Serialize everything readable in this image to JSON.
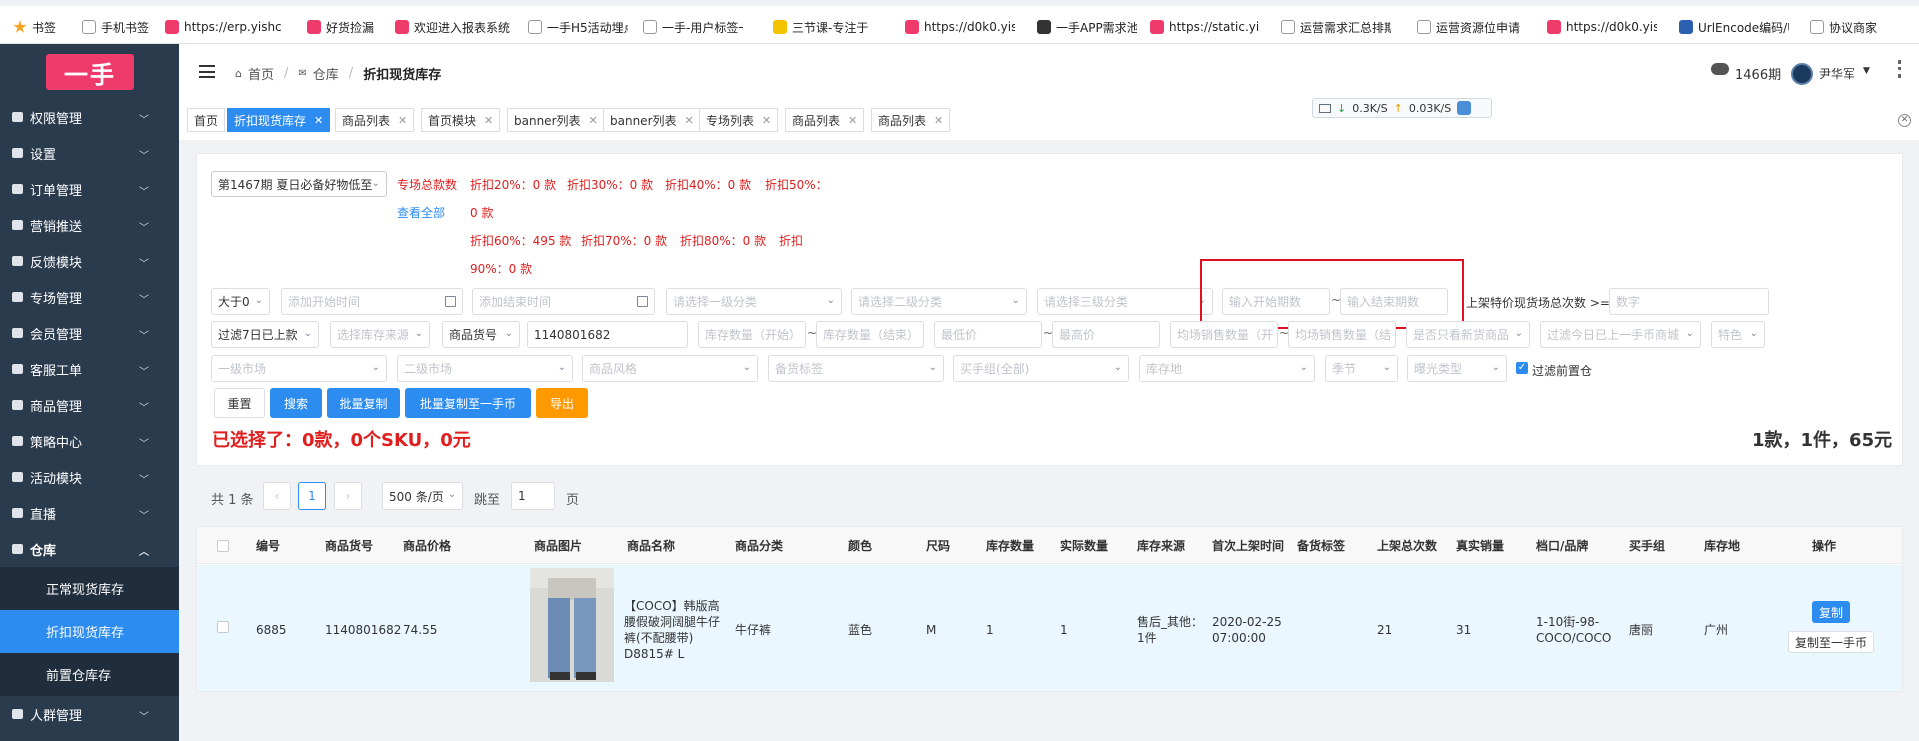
{
  "bookmarks": [
    {
      "label": "书签",
      "icon": "star-icon",
      "color": "#f5a623"
    },
    {
      "label": "手机书签",
      "icon": "page-icon",
      "color": "#999999"
    },
    {
      "label": "https://erp.yishc",
      "icon": "site-icon",
      "color": "#ee3b6b"
    },
    {
      "label": "好货捡漏",
      "icon": "site-icon",
      "color": "#ee3b6b"
    },
    {
      "label": "欢迎进入报表系统",
      "icon": "site-icon",
      "color": "#ee3b6b"
    },
    {
      "label": "一手H5活动埋点",
      "icon": "page-icon",
      "color": "#999999"
    },
    {
      "label": "一手-用户标签一",
      "icon": "page-icon",
      "color": "#999999"
    },
    {
      "label": "三节课-专注于",
      "icon": "site-icon",
      "color": "#f5c400"
    },
    {
      "label": "https://d0k0.yish",
      "icon": "site-icon",
      "color": "#ee3b6b"
    },
    {
      "label": "一手APP需求池",
      "icon": "site-icon",
      "color": "#333333"
    },
    {
      "label": "https://static.yish",
      "icon": "site-icon",
      "color": "#ee3b6b"
    },
    {
      "label": "运营需求汇总排期",
      "icon": "page-icon",
      "color": "#999999"
    },
    {
      "label": "运营资源位申请",
      "icon": "page-icon",
      "color": "#999999"
    },
    {
      "label": "https://d0k0.yish",
      "icon": "site-icon",
      "color": "#ee3b6b"
    },
    {
      "label": "UrlEncode编码/U",
      "icon": "site-icon",
      "color": "#2d5fb0"
    },
    {
      "label": "协议商家",
      "icon": "page-icon",
      "color": "#999999"
    }
  ],
  "sidebar": {
    "logo": "一手",
    "items": [
      {
        "label": "权限管理"
      },
      {
        "label": "设置"
      },
      {
        "label": "订单管理"
      },
      {
        "label": "营销推送"
      },
      {
        "label": "反馈模块"
      },
      {
        "label": "专场管理"
      },
      {
        "label": "会员管理"
      },
      {
        "label": "客服工单"
      },
      {
        "label": "商品管理"
      },
      {
        "label": "策略中心"
      },
      {
        "label": "活动模块"
      },
      {
        "label": "直播"
      },
      {
        "label": "仓库"
      }
    ],
    "subitems": [
      {
        "label": "正常现货库存"
      },
      {
        "label": "折扣现货库存"
      },
      {
        "label": "前置仓库存"
      }
    ],
    "last": {
      "label": "人群管理"
    }
  },
  "header": {
    "breadcrumb": [
      {
        "label": "首页"
      },
      {
        "label": "仓库"
      },
      {
        "label": "折扣现货库存"
      }
    ],
    "period": "1466期",
    "user": "尹华军",
    "net_down": "0.3K/S",
    "net_up": "0.03K/S"
  },
  "tabs": [
    {
      "label": "首页"
    },
    {
      "label": "折扣现货库存"
    },
    {
      "label": "商品列表"
    },
    {
      "label": "首页模块"
    },
    {
      "label": "banner列表"
    },
    {
      "label": "banner列表"
    },
    {
      "label": "专场列表"
    },
    {
      "label": "商品列表"
    },
    {
      "label": "商品列表"
    }
  ],
  "filters": {
    "period_select": "第1467期 夏日必备好物低至",
    "total_label": "专场总款数",
    "view_all": "查看全部",
    "total_count": "0 款",
    "d20": "折扣20%：0 款",
    "d30": "折扣30%：0 款",
    "d40": "折扣40%：0 款",
    "d50": "折扣50%：",
    "d60": "折扣60%：495 款",
    "d70": "折扣70%：0 款",
    "d80": "折扣80%：0 款",
    "d90a": "折扣",
    "d90b": "90%：0 款",
    "gt_select": "大于0",
    "start_time_ph": "添加开始时间",
    "end_time_ph": "添加结束时间",
    "cat1_ph": "请选择一级分类",
    "cat2_ph": "请选择二级分类",
    "cat3_ph": "请选择三级分类",
    "start_period_ph": "输入开始期数",
    "end_period_ph": "输入结束期数",
    "shelf_label": "上架特价现货场总次数 >=",
    "shelf_ph": "数字",
    "past7": "过滤7日已上款",
    "stock_src_ph": "选择库存来源",
    "goods_no_select": "商品货号",
    "goods_no_value": "1140801682",
    "stock_min_ph": "库存数量（开始）",
    "stock_max_ph": "库存数量（结束）",
    "price_min_ph": "最低价",
    "price_max_ph": "最高价",
    "avg_sale_min_ph": "均场销售数量（开",
    "avg_sale_max_ph": "均场销售数量（结",
    "has_goods_ph": "是否只看新货商品",
    "filter_today_ph": "过滤今日已上一手币商城",
    "feature_ph": "特色",
    "market1_ph": "一级市场",
    "market2_ph": "二级市场",
    "style_ph": "商品风格",
    "backup_tag_ph": "备货标签",
    "buyer_ph": "买手组(全部)",
    "warehouse_ph": "库存地",
    "season_ph": "季节",
    "exposure_ph": "曝光类型",
    "front_filter": "过滤前置仓"
  },
  "actions": {
    "reset": "重置",
    "search": "搜索",
    "batch_copy": "批量复制",
    "batch_copy_coin": "批量复制至一手币",
    "export": "导出"
  },
  "selection": {
    "summary": "已选择了：0款，0个SKU，0元",
    "totals": "1款，1件，65元"
  },
  "pagination": {
    "total": "共 1 条",
    "page": "1",
    "size": "500 条/页",
    "jump_label": "跳至",
    "jump_value": "1",
    "page_suffix": "页"
  },
  "table": {
    "columns": [
      "编号",
      "商品货号",
      "商品价格",
      "商品图片",
      "商品名称",
      "商品分类",
      "颜色",
      "尺码",
      "库存数量",
      "实际数量",
      "库存来源",
      "首次上架时间",
      "备货标签",
      "上架总次数",
      "真实销量",
      "档口/品牌",
      "买手组",
      "库存地",
      "操作"
    ],
    "row": {
      "id": "6885",
      "sku": "1140801682",
      "price": "74.55",
      "name": "【COCO】韩版高腰假破洞阔腿牛仔裤(不配腰带) D8815# L",
      "category": "牛仔裤",
      "color": "蓝色",
      "size": "M",
      "stock": "1",
      "actual": "1",
      "source": "售后_其他：1件",
      "first_time": "2020-02-25 07:00:00",
      "tag": "",
      "shelf_count": "21",
      "sales": "31",
      "brand": "1-10街-98-COCO/COCO",
      "buyer": "唐丽",
      "warehouse": "广州",
      "op_copy": "复制",
      "op_copy_coin": "复制至一手币"
    }
  },
  "colors": {
    "accent": "#2d8cf0",
    "sidebar": "#2b3b4e",
    "logo": "#ee3b6b",
    "danger": "#e01e1e",
    "warn": "#ff9900"
  }
}
